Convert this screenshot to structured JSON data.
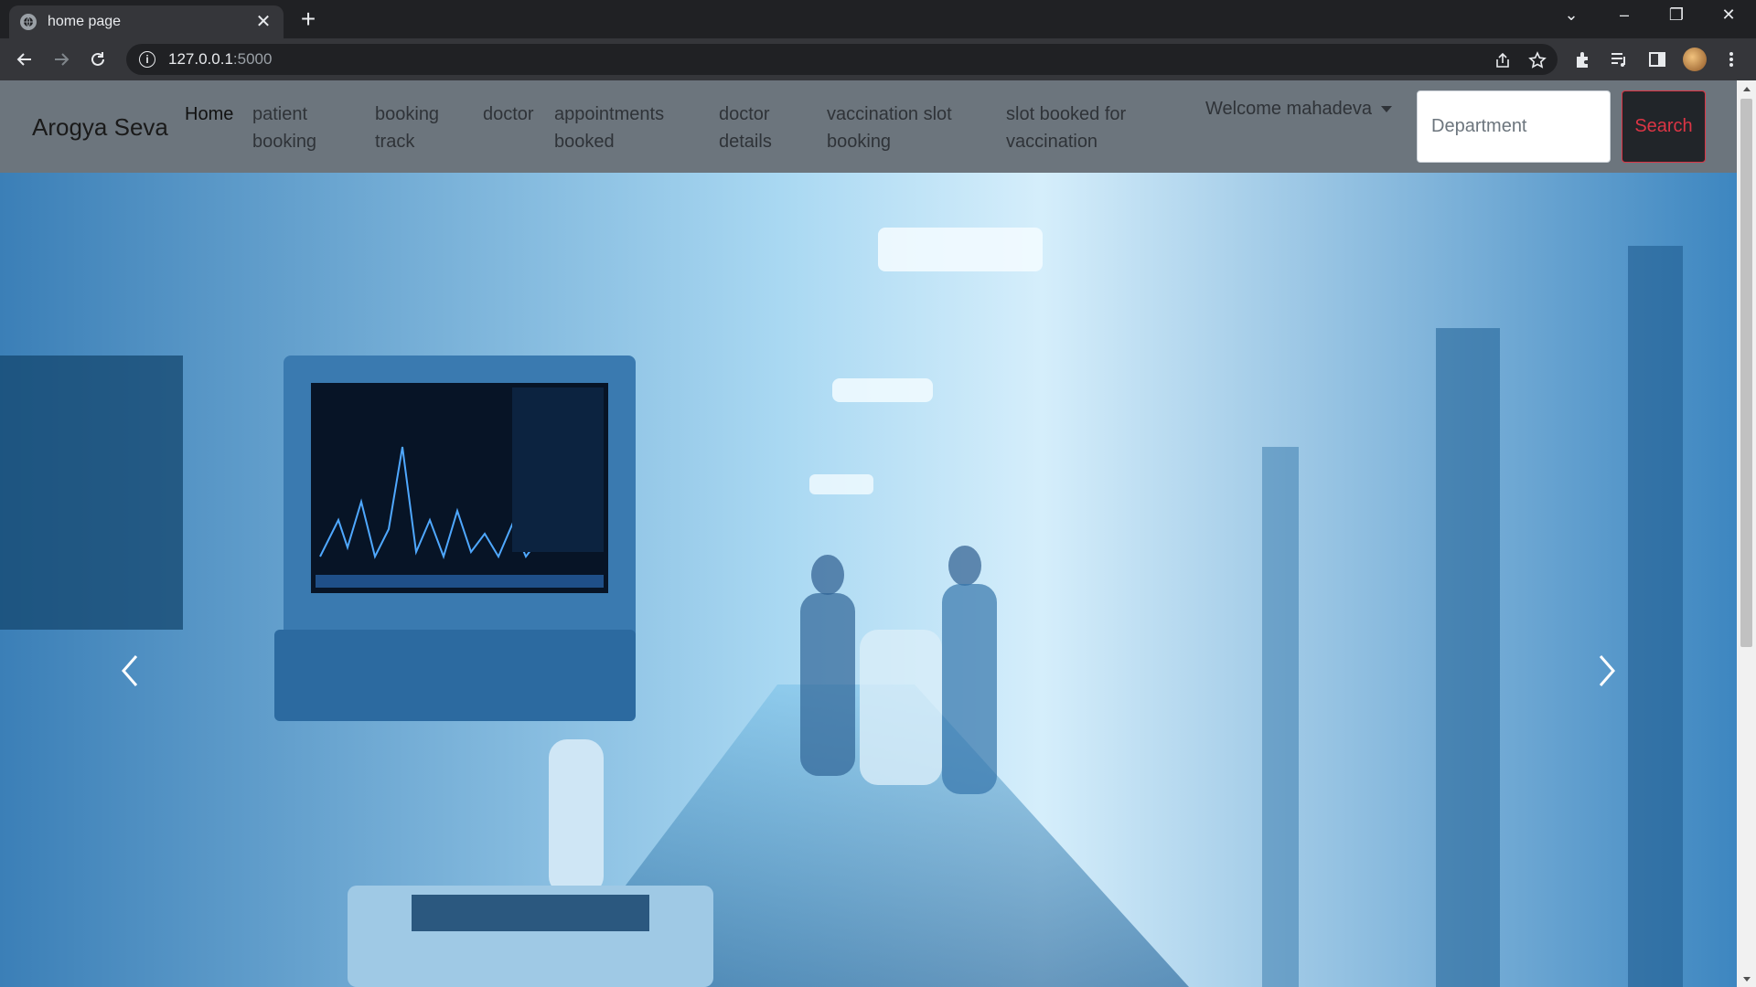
{
  "browser": {
    "tab_title": "home page",
    "url_host": "127.0.0.1",
    "url_port": ":5000"
  },
  "navbar": {
    "brand": "Arogya Seva",
    "links": [
      {
        "label": "Home",
        "active": true
      },
      {
        "label": "patient booking"
      },
      {
        "label": "booking track"
      },
      {
        "label": "doctor"
      },
      {
        "label": "appointments booked"
      },
      {
        "label": "doctor details"
      },
      {
        "label": "vaccination slot booking"
      },
      {
        "label": "slot booked for vaccination"
      }
    ],
    "user_menu": "Welcome mahadeva",
    "search": {
      "placeholder": "Department",
      "button_label": "Search"
    }
  },
  "colors": {
    "navbar_bg": "#6c757d",
    "search_button_text": "#dc3545",
    "search_button_bg": "#212529"
  },
  "carousel": {
    "icons": [
      "chevron-left-icon",
      "chevron-right-icon"
    ]
  }
}
